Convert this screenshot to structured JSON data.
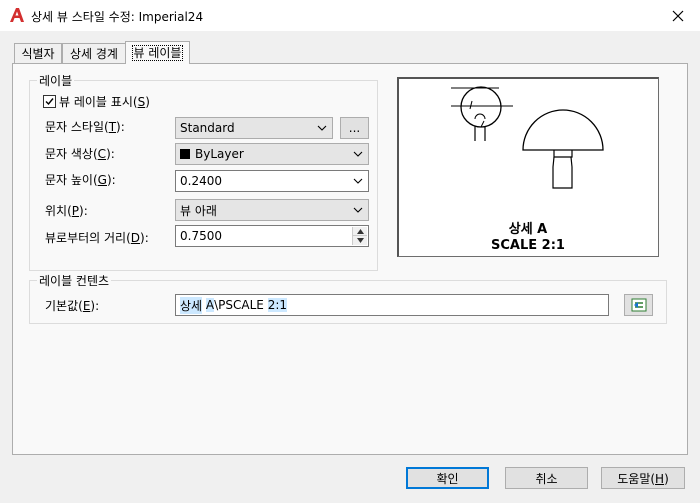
{
  "window": {
    "title": "상세 뷰 스타일 수정: Imperial24"
  },
  "tabs": [
    {
      "label": "식별자"
    },
    {
      "label": "상세 경계"
    },
    {
      "label": "뷰 레이블"
    }
  ],
  "label_group": {
    "title": "레이블",
    "show_checkbox": {
      "label": "뷰 레이블 표시(",
      "key": "S",
      "suffix": ")",
      "checked": true
    },
    "text_style": {
      "label": "문자 스타일(",
      "key": "T",
      "suffix": "):",
      "value": "Standard",
      "browse_label": "..."
    },
    "text_color": {
      "label": "문자 색상(",
      "key": "C",
      "suffix": "):",
      "value": "ByLayer",
      "swatch_color": "#000000"
    },
    "text_height": {
      "label": "문자 높이(",
      "key": "G",
      "suffix": "):",
      "value": "0.2400"
    },
    "position": {
      "label": "위치(",
      "key": "P",
      "suffix": "):",
      "value": "뷰 아래"
    },
    "distance": {
      "label": "뷰로부터의 거리(",
      "key": "D",
      "suffix": "):",
      "value": "0.7500"
    }
  },
  "preview": {
    "caption_line1": "상세 A",
    "caption_line2": "SCALE 2:1"
  },
  "contents_group": {
    "title": "레이블 컨텐츠",
    "default_label": {
      "label": "기본값(",
      "key": "E",
      "suffix": "):"
    },
    "default_value": {
      "seg1": "상세",
      "seg2": " ",
      "seg3": "A",
      "seg4": "\\PSCALE ",
      "seg5": "2:1"
    },
    "insert_field_icon": "insert-field-icon"
  },
  "buttons": {
    "ok": "확인",
    "cancel": "취소",
    "help_prefix": "도움말(",
    "help_key": "H",
    "help_suffix": ")"
  },
  "colors": {
    "accent": "#0078d7",
    "app_icon": "#d32f2f"
  }
}
